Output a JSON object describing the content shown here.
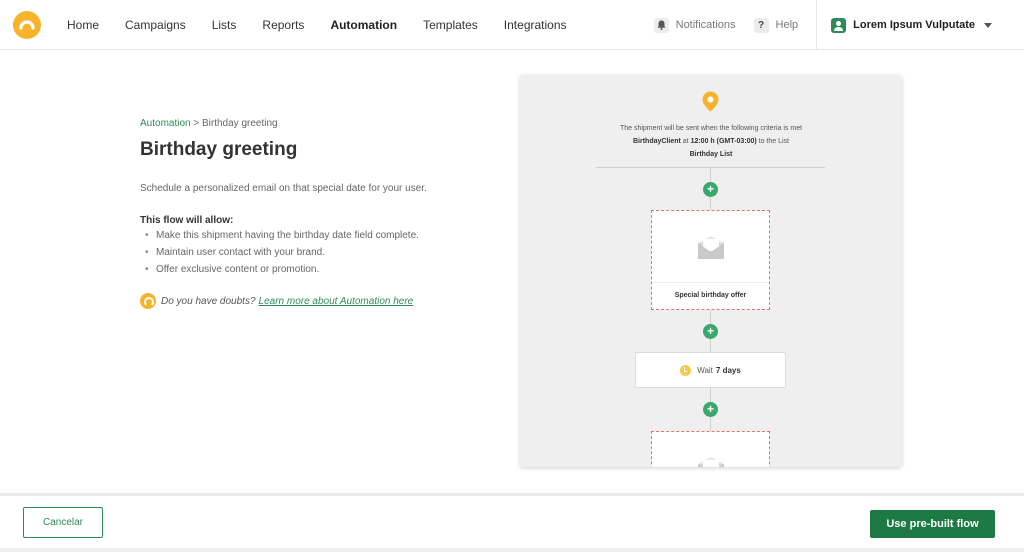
{
  "nav": {
    "links": [
      {
        "label": "Home"
      },
      {
        "label": "Campaigns"
      },
      {
        "label": "Lists"
      },
      {
        "label": "Reports"
      },
      {
        "label": "Automation",
        "active": true
      },
      {
        "label": "Templates"
      },
      {
        "label": "Integrations"
      }
    ],
    "notifications_label": "Notifications",
    "help_label": "Help",
    "help_icon": "?",
    "user_name": "Lorem Ipsum Vulputate"
  },
  "page": {
    "breadcrumb_root": "Automation",
    "breadcrumb_sep": " > ",
    "breadcrumb_current": "Birthday greeting",
    "title": "Birthday greeting",
    "description": "Schedule a personalized email on that special date for your user.",
    "allow_title": "This flow will allow:",
    "bullets": [
      "Make this shipment having the birthday date field complete.",
      "Maintain user contact with your brand.",
      "Offer exclusive content or promotion."
    ],
    "doubts_text": "Do you have doubts?",
    "doubts_link": "Learn more about Automation here"
  },
  "flow": {
    "criteria_line1": "The shipment will be sent when the following criteria is met",
    "criteria_field": "BirthdayClient",
    "criteria_at": " at ",
    "criteria_time": "12:00 h (GMT-03:00)",
    "criteria_to": " to the List",
    "criteria_list": "Birthday List",
    "email_label": "Special birthday offer",
    "wait_prefix": "Wait",
    "wait_value": "7 days"
  },
  "footer": {
    "cancel_label": "Cancelar",
    "use_label": "Use pre-built flow"
  },
  "colors": {
    "brand_yellow": "#f7b32b",
    "green": "#2e8b57",
    "primary_button": "#1e7a44",
    "plus_green": "#3aa76d",
    "dashed_border": "#e9735d"
  }
}
